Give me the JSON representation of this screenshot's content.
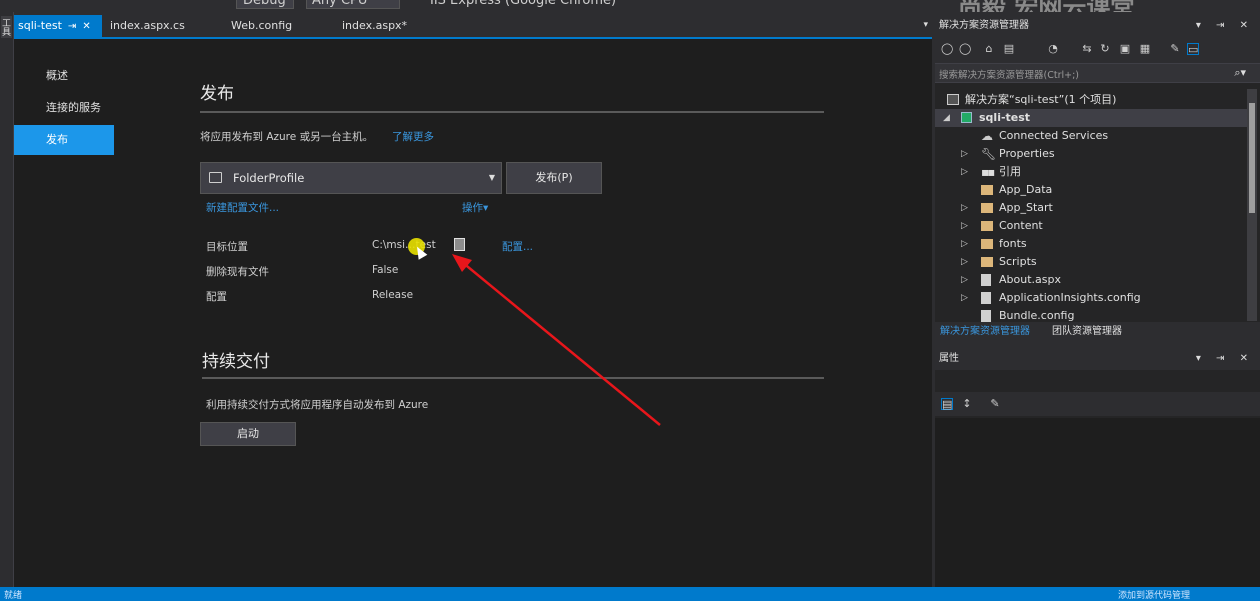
{
  "toolbar": {
    "config_label": "Debug",
    "platform_label": "Any CPU",
    "run_label": "IIS Express (Google Chrome)",
    "watermark_text": "尚毅 宏网云课堂"
  },
  "side_tab": {
    "label": "工具箱"
  },
  "tabs": [
    {
      "label": "sqli-test",
      "pin": "⇥",
      "close": "✕"
    },
    {
      "label": "index.aspx.cs"
    },
    {
      "label": "Web.config"
    },
    {
      "label": "index.aspx*"
    }
  ],
  "tabs_dropdown": "▾",
  "nav": {
    "overview": "概述",
    "connected": "连接的服务",
    "publish": "发布"
  },
  "publish": {
    "title": "发布",
    "description": "将应用发布到 Azure 或另一台主机。",
    "learn_more": "了解更多",
    "profile_value": "FolderProfile",
    "publish_button": "发布(P)",
    "new_profile_link": "新建配置文件...",
    "actions_link": "操作▾",
    "rows": [
      {
        "label": "目标位置",
        "value": "C:\\msi…test"
      },
      {
        "label": "删除现有文件",
        "value": "False"
      },
      {
        "label": "配置",
        "value": "Release"
      }
    ],
    "configure_link": "配置..."
  },
  "cd": {
    "title": "持续交付",
    "description": "利用持续交付方式将应用程序自动发布到 Azure",
    "start_button": "启动"
  },
  "solution_explorer": {
    "title": "解决方案资源管理器",
    "pane_controls": "▾ ⇥ ✕",
    "search_placeholder": "搜索解决方案资源管理器(Ctrl+;)",
    "search_icon": "⌕▾",
    "tree": [
      "解决方案“sqli-test”(1 个项目)",
      "sqli-test",
      "Connected Services",
      "Properties",
      "引用",
      "App_Data",
      "App_Start",
      "Content",
      "fonts",
      "Scripts",
      "About.aspx",
      "ApplicationInsights.config",
      "Bundle.config"
    ],
    "tab_explorer": "解决方案资源管理器",
    "tab_team": "团队资源管理器"
  },
  "properties": {
    "title": "属性",
    "pane_controls": "▾ ⇥ ✕"
  },
  "status": {
    "left": "就绪",
    "right": "添加到源代码管理"
  },
  "colors": {
    "accent": "#007acc",
    "link": "#3a96dd",
    "annotation_arrow": "#e8161b",
    "cursor_highlight": "#e8e000"
  }
}
